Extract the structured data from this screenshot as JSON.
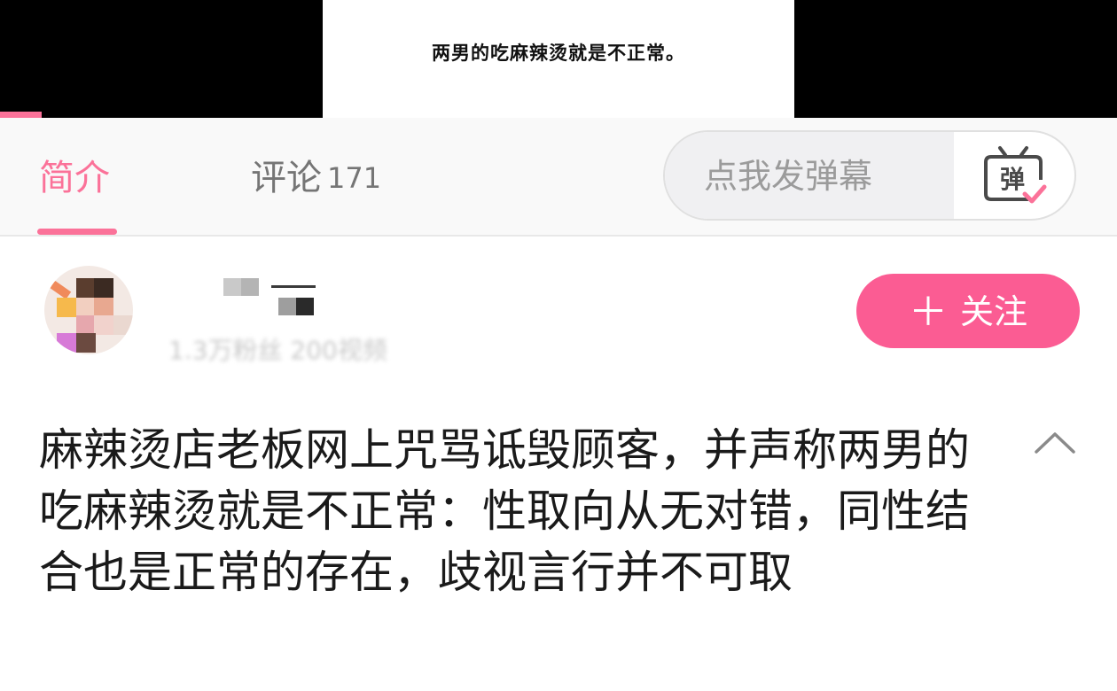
{
  "video": {
    "caption": "两男的吃麻辣烫就是不正常。"
  },
  "tabs": [
    {
      "label": "简介"
    },
    {
      "label": "评论",
      "count": "171"
    }
  ],
  "danmaku": {
    "placeholder": "点我发弹幕",
    "toggle_icon": "danmaku-toggle-icon",
    "toggle_glyph": "弹"
  },
  "uploader": {
    "follow_label": "关注",
    "stats_blurred": "1.3万粉丝  200视频"
  },
  "title": "麻辣烫店老板网上咒骂诋毁顾客，并声称两男的吃麻辣烫就是不正常：性取向从无对错，同性结合也是正常的存在，歧视言行并不可取",
  "colors": {
    "accent": "#fb7299",
    "follow": "#fb5c93"
  }
}
